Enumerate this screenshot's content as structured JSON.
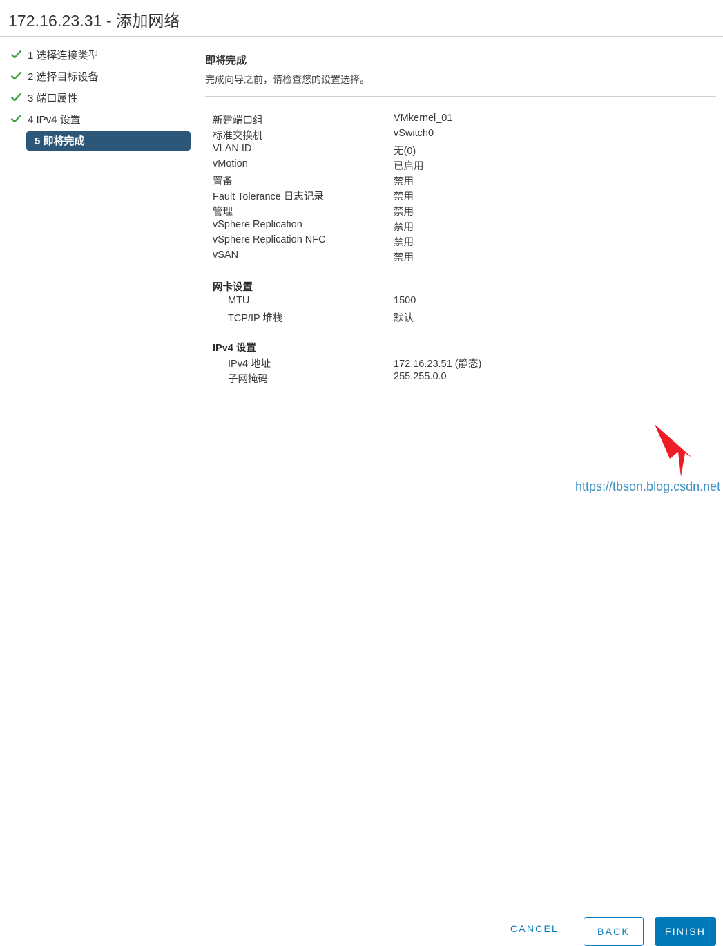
{
  "window": {
    "title": "172.16.23.31 - 添加网络"
  },
  "steps": [
    {
      "number": "1",
      "label": "1 选择连接类型",
      "state": "done"
    },
    {
      "number": "2",
      "label": "2 选择目标设备",
      "state": "done"
    },
    {
      "number": "3",
      "label": "3 端口属性",
      "state": "done"
    },
    {
      "number": "4",
      "label": "4 IPv4 设置",
      "state": "done"
    },
    {
      "number": "5",
      "label": "5 即将完成",
      "state": "active"
    }
  ],
  "panel": {
    "heading": "即将完成",
    "subheading": "完成向导之前，请检查您的设置选择。"
  },
  "summary": {
    "rows": [
      {
        "key": "新建端口组",
        "value": "VMkernel_01"
      },
      {
        "key": "标准交换机",
        "value": "vSwitch0"
      },
      {
        "key": "VLAN ID",
        "value": "无(0)"
      },
      {
        "key": "vMotion",
        "value": "已启用"
      },
      {
        "key": "置备",
        "value": "禁用"
      },
      {
        "key": "Fault Tolerance 日志记录",
        "value": "禁用"
      },
      {
        "key": "管理",
        "value": "禁用"
      },
      {
        "key": "vSphere Replication",
        "value": "禁用"
      },
      {
        "key": "vSphere Replication NFC",
        "value": "禁用"
      },
      {
        "key": "vSAN",
        "value": "禁用"
      }
    ],
    "sections": [
      {
        "title": "网卡设置",
        "rows": [
          {
            "key": "MTU",
            "value": "1500"
          },
          {
            "key": "TCP/IP 堆栈",
            "value": "默认"
          }
        ]
      },
      {
        "title": "IPv4 设置",
        "rows": [
          {
            "key": "IPv4 地址",
            "value": "172.16.23.51 (静态)"
          },
          {
            "key": "子网掩码",
            "value": "255.255.0.0"
          }
        ]
      }
    ]
  },
  "footer": {
    "cancel_label": "CANCEL",
    "back_label": "BACK",
    "finish_label": "FINISH"
  },
  "annotation": {
    "arrow_color": "#ee1c24",
    "target": "finish-button"
  },
  "watermark": {
    "text": "https://tbson.blog.csdn.net"
  },
  "colors": {
    "active_step_bg": "#2d5778",
    "check_green": "#45a045",
    "primary_blue": "#0079b8",
    "link_blue": "#0a7bc0",
    "divider": "#cfcfcf"
  }
}
